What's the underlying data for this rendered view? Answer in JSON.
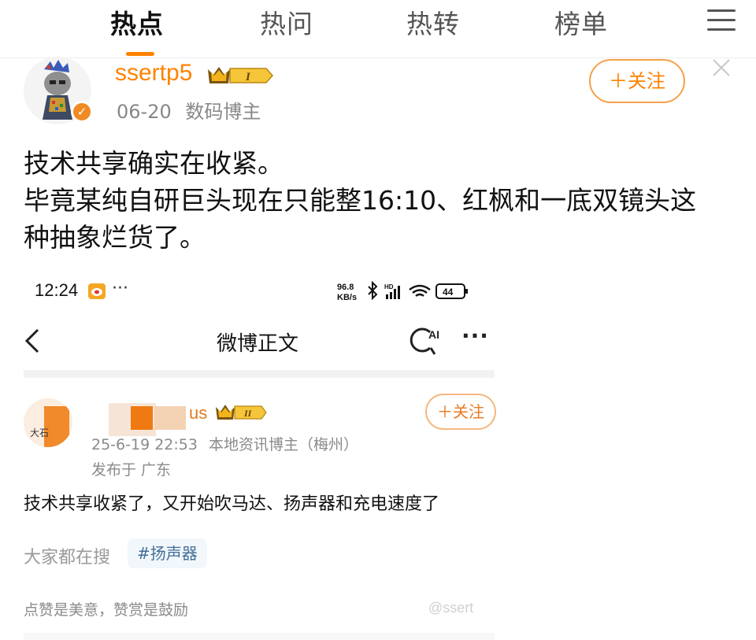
{
  "topnav": {
    "tabs": [
      {
        "label": "热点",
        "active": true
      },
      {
        "label": "热问",
        "active": false
      },
      {
        "label": "热转",
        "active": false
      },
      {
        "label": "榜单",
        "active": false
      }
    ],
    "menu_icon": "hamburger-menu-icon",
    "accent_color": "#ff8200"
  },
  "post": {
    "author": {
      "username": "ssertp5",
      "vip_level": "I",
      "verified_icon": "verified-badge-icon"
    },
    "date": "06-20",
    "author_title": "数码博主",
    "follow_label": "＋关注",
    "text_lines": [
      "技术共享确实在收紧。",
      "毕竟某纯自研巨头现在只能整16:10、红枫和一底双镜头这",
      "种抽象烂货了。"
    ]
  },
  "embedded": {
    "status_bar": {
      "time": "12:24",
      "dots": "···",
      "net_speed": "96.8",
      "net_unit": "KB/s",
      "signal_label": "HD",
      "battery": "44"
    },
    "header": {
      "title": "微博正文",
      "ai_label": "AI",
      "more": "···"
    },
    "post": {
      "username_tail": "us",
      "vip_level": "II",
      "avatar_text": "大石",
      "timestamp": "25-6-19 22:53",
      "author_desc": "本地资讯博主（梅州）",
      "location": "发布于 广东",
      "follow_label": "＋关注",
      "text": "技术共享收紧了，又开始吹马达、扬声器和充电速度了"
    },
    "search": {
      "label": "大家都在搜",
      "hashtag": "#扬声器"
    },
    "footer": {
      "text": "点赞是美意，赞赏是鼓励",
      "watermark": "@ssert"
    }
  }
}
